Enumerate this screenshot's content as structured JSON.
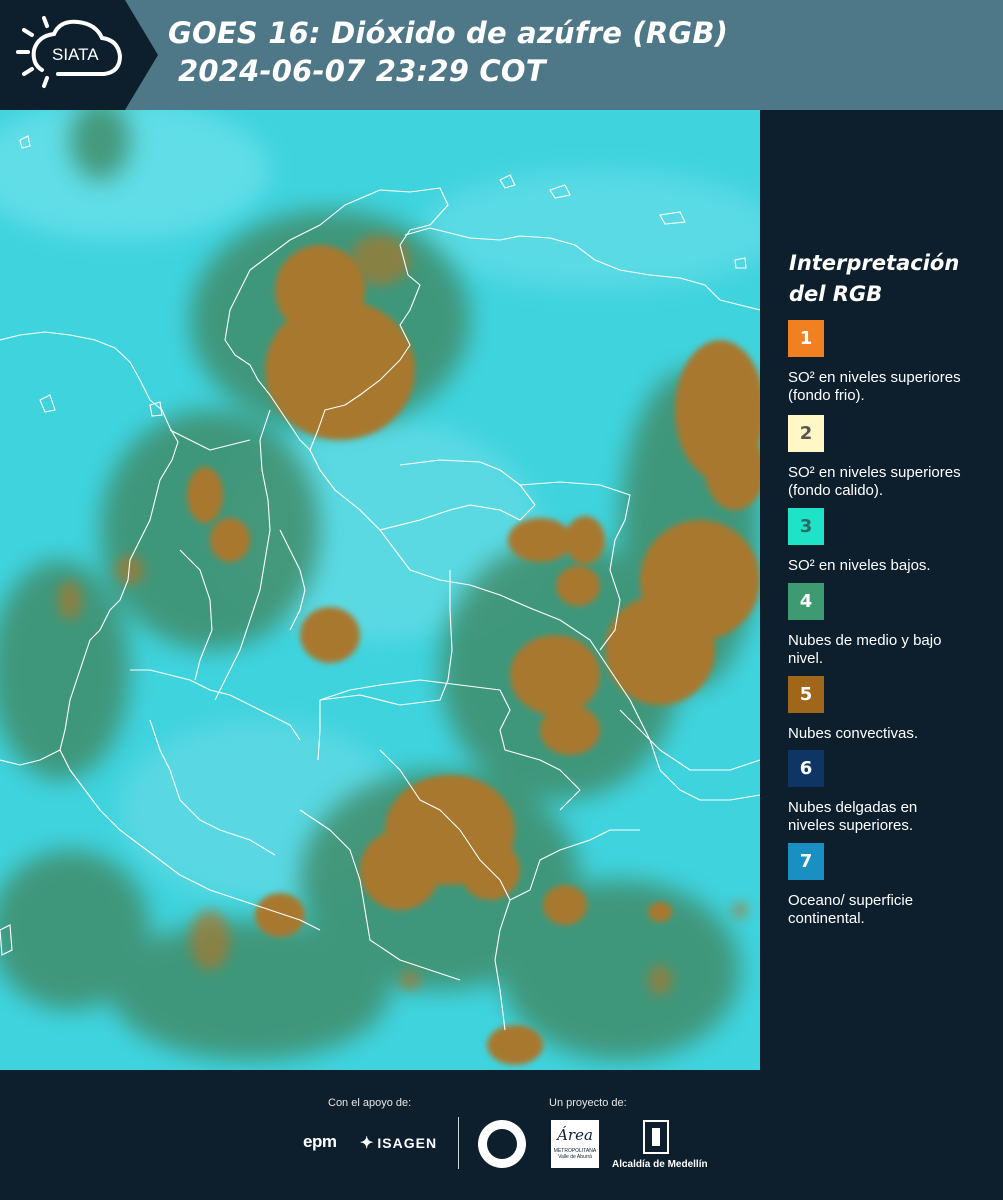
{
  "header": {
    "logo_text": "SIATA",
    "title_line1": "GOES 16: Dióxido de azúfre (RGB)",
    "title_line2": "2024-06-07 23:29 COT"
  },
  "legend": {
    "title_line1": "Interpretación",
    "title_line2": "del RGB",
    "items": [
      {
        "number": "1",
        "color": "#f28020",
        "text": "SO² en niveles superiores (fondo frio)."
      },
      {
        "number": "2",
        "color": "#fff7c6",
        "text": "SO² en niveles superiores (fondo calido)."
      },
      {
        "number": "3",
        "color": "#1fe3c6",
        "text": "SO² en niveles bajos."
      },
      {
        "number": "4",
        "color": "#3e9a70",
        "text": "Nubes de medio y bajo nivel."
      },
      {
        "number": "5",
        "color": "#a0661a",
        "text": "Nubes convectivas."
      },
      {
        "number": "6",
        "color": "#0f3564",
        "text": "Nubes delgadas en niveles superiores."
      },
      {
        "number": "7",
        "color": "#1a8fc2",
        "text": "Oceano/ superficie continental."
      }
    ]
  },
  "footer": {
    "support_label": "Con el apoyo de:",
    "project_label": "Un proyecto de:",
    "epm": "epm",
    "isagen": "ISAGEN",
    "area_logo": "Área",
    "area_sub": "METROPOLITANA Valle de Aburrá",
    "alcaldia": "Alcaldía de Medellín"
  },
  "map": {
    "background_color": "#3fd3de",
    "convective_color": "#a8782e",
    "midlevel_color": "#3f8d6a",
    "border_color": "#ffffff"
  }
}
